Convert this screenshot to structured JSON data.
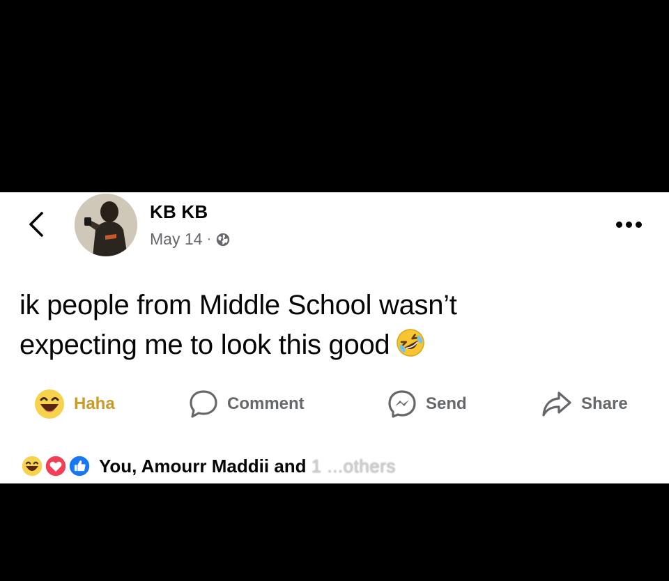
{
  "post": {
    "author": "KB KB",
    "date": "May 14",
    "separator": "·",
    "audience_icon": "globe-icon",
    "text_line1": "ik people from Middle School wasn’t",
    "text_line2": "expecting me to look this good",
    "text_emoji": "rolling-on-floor-laughing-emoji"
  },
  "header": {
    "back_icon": "chevron-left-icon",
    "more_icon": "more-horizontal-icon"
  },
  "actions": {
    "haha_label": "Haha",
    "comment_label": "Comment",
    "send_label": "Send",
    "share_label": "Share"
  },
  "reactions": {
    "summary": "You, Amourr Maddii and",
    "watermark": "1 ...others"
  },
  "colors": {
    "haha": "#c89b2a",
    "like_blue": "#1877f2",
    "love_red": "#f33e58",
    "secondary_text": "#65676b"
  }
}
